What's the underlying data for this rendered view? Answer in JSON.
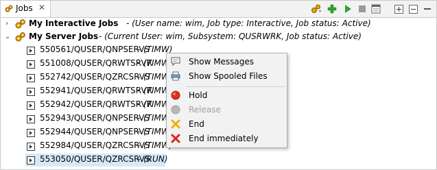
{
  "tab": {
    "label": "Jobs",
    "close": "✕"
  },
  "toolbar": {
    "icons": [
      "refresh-icon",
      "add-icon",
      "run-icon",
      "stop-icon",
      "view-icon",
      "expand-icon",
      "collapse-icon"
    ]
  },
  "tree": {
    "interactive": {
      "label": "My Interactive Jobs",
      "details": "- (User name: wim, Job type: Interactive, Job status: Active)"
    },
    "server": {
      "label": "My Server Jobs",
      "details": "- (Current User: wim, Subsystem: QUSRWRK, Job status: Active)"
    },
    "jobs": [
      {
        "name": "550561/QUSER/QNPSERVS",
        "status": "(TIMW)"
      },
      {
        "name": "551008/QUSER/QRWTSRVR",
        "status": "(TIMW)"
      },
      {
        "name": "552742/QUSER/QZRCSRVS",
        "status": "(TIMW)"
      },
      {
        "name": "552941/QUSER/QRWTSRVR",
        "status": "(TIMW)"
      },
      {
        "name": "552942/QUSER/QRWTSRVR",
        "status": "(TIMW)"
      },
      {
        "name": "552943/QUSER/QNPSERVS",
        "status": "(TIMW)"
      },
      {
        "name": "552944/QUSER/QNPSERVS",
        "status": "(TIMW)"
      },
      {
        "name": "552984/QUSER/QZRCSRVS",
        "status": "(TIMW)"
      },
      {
        "name": "553050/QUSER/QZRCSRVS",
        "status": "(RUN)"
      }
    ]
  },
  "context_menu": {
    "show_messages": "Show Messages",
    "show_spooled_files": "Show Spooled Files",
    "hold": "Hold",
    "release": "Release",
    "end": "End",
    "end_immediately": "End immediately"
  },
  "colors": {
    "selection": "#d6e9f8",
    "hold": "#e03020",
    "end": "#f0b000",
    "end_immediately": "#e02020"
  }
}
